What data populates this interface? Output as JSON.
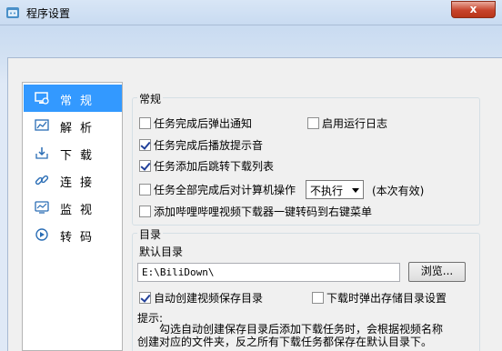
{
  "window": {
    "title": "程序设置",
    "close_label": "x"
  },
  "nav": {
    "items": [
      {
        "label": "常规",
        "icon": "monitor-settings-icon",
        "active": true
      },
      {
        "label": "解析",
        "icon": "chart-icon"
      },
      {
        "label": "下载",
        "icon": "download-icon"
      },
      {
        "label": "连接",
        "icon": "link-icon"
      },
      {
        "label": "监视",
        "icon": "watch-icon"
      },
      {
        "label": "转码",
        "icon": "convert-icon"
      }
    ]
  },
  "general": {
    "title": "常规",
    "notify_on_complete": {
      "label": "任务完成后弹出通知",
      "checked": false
    },
    "enable_log": {
      "label": "启用运行日志",
      "checked": false
    },
    "play_sound": {
      "label": "任务完成后播放提示音",
      "checked": true
    },
    "jump_to_list": {
      "label": "任务添加后跳转下载列表",
      "checked": true
    },
    "computer_action": {
      "label": "任务全部完成后对计算机操作",
      "checked": false,
      "selected": "不执行",
      "note": "(本次有效)"
    },
    "context_menu": {
      "label": "添加哔哩哔哩视频下载器一键转码到右键菜单",
      "checked": false
    }
  },
  "directory": {
    "title": "目录",
    "default_label": "默认目录",
    "path": "E:\\BiliDown\\",
    "browse_label": "浏览...",
    "auto_create": {
      "label": "自动创建视频保存目录",
      "checked": true
    },
    "popup_on_download": {
      "label": "下载时弹出存储目录设置",
      "checked": false
    },
    "hint_label": "提示:",
    "hint_line1": "勾选自动创建保存目录后添加下载任务时，会根据视频名称",
    "hint_line2": "创建对应的文件夹，反之所有下载任务都保存在默认目录下。"
  }
}
